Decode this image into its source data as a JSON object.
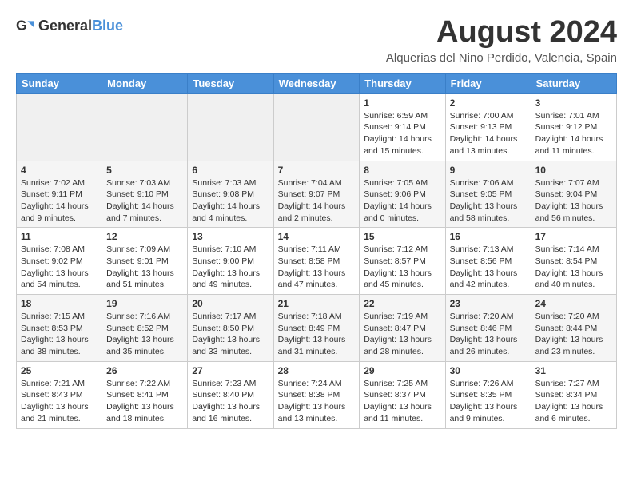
{
  "header": {
    "logo_general": "General",
    "logo_blue": "Blue",
    "title": "August 2024",
    "location": "Alquerias del Nino Perdido, Valencia, Spain"
  },
  "calendar": {
    "days_of_week": [
      "Sunday",
      "Monday",
      "Tuesday",
      "Wednesday",
      "Thursday",
      "Friday",
      "Saturday"
    ],
    "weeks": [
      [
        {
          "day": "",
          "info": ""
        },
        {
          "day": "",
          "info": ""
        },
        {
          "day": "",
          "info": ""
        },
        {
          "day": "",
          "info": ""
        },
        {
          "day": "1",
          "info": "Sunrise: 6:59 AM\nSunset: 9:14 PM\nDaylight: 14 hours\nand 15 minutes."
        },
        {
          "day": "2",
          "info": "Sunrise: 7:00 AM\nSunset: 9:13 PM\nDaylight: 14 hours\nand 13 minutes."
        },
        {
          "day": "3",
          "info": "Sunrise: 7:01 AM\nSunset: 9:12 PM\nDaylight: 14 hours\nand 11 minutes."
        }
      ],
      [
        {
          "day": "4",
          "info": "Sunrise: 7:02 AM\nSunset: 9:11 PM\nDaylight: 14 hours\nand 9 minutes."
        },
        {
          "day": "5",
          "info": "Sunrise: 7:03 AM\nSunset: 9:10 PM\nDaylight: 14 hours\nand 7 minutes."
        },
        {
          "day": "6",
          "info": "Sunrise: 7:03 AM\nSunset: 9:08 PM\nDaylight: 14 hours\nand 4 minutes."
        },
        {
          "day": "7",
          "info": "Sunrise: 7:04 AM\nSunset: 9:07 PM\nDaylight: 14 hours\nand 2 minutes."
        },
        {
          "day": "8",
          "info": "Sunrise: 7:05 AM\nSunset: 9:06 PM\nDaylight: 14 hours\nand 0 minutes."
        },
        {
          "day": "9",
          "info": "Sunrise: 7:06 AM\nSunset: 9:05 PM\nDaylight: 13 hours\nand 58 minutes."
        },
        {
          "day": "10",
          "info": "Sunrise: 7:07 AM\nSunset: 9:04 PM\nDaylight: 13 hours\nand 56 minutes."
        }
      ],
      [
        {
          "day": "11",
          "info": "Sunrise: 7:08 AM\nSunset: 9:02 PM\nDaylight: 13 hours\nand 54 minutes."
        },
        {
          "day": "12",
          "info": "Sunrise: 7:09 AM\nSunset: 9:01 PM\nDaylight: 13 hours\nand 51 minutes."
        },
        {
          "day": "13",
          "info": "Sunrise: 7:10 AM\nSunset: 9:00 PM\nDaylight: 13 hours\nand 49 minutes."
        },
        {
          "day": "14",
          "info": "Sunrise: 7:11 AM\nSunset: 8:58 PM\nDaylight: 13 hours\nand 47 minutes."
        },
        {
          "day": "15",
          "info": "Sunrise: 7:12 AM\nSunset: 8:57 PM\nDaylight: 13 hours\nand 45 minutes."
        },
        {
          "day": "16",
          "info": "Sunrise: 7:13 AM\nSunset: 8:56 PM\nDaylight: 13 hours\nand 42 minutes."
        },
        {
          "day": "17",
          "info": "Sunrise: 7:14 AM\nSunset: 8:54 PM\nDaylight: 13 hours\nand 40 minutes."
        }
      ],
      [
        {
          "day": "18",
          "info": "Sunrise: 7:15 AM\nSunset: 8:53 PM\nDaylight: 13 hours\nand 38 minutes."
        },
        {
          "day": "19",
          "info": "Sunrise: 7:16 AM\nSunset: 8:52 PM\nDaylight: 13 hours\nand 35 minutes."
        },
        {
          "day": "20",
          "info": "Sunrise: 7:17 AM\nSunset: 8:50 PM\nDaylight: 13 hours\nand 33 minutes."
        },
        {
          "day": "21",
          "info": "Sunrise: 7:18 AM\nSunset: 8:49 PM\nDaylight: 13 hours\nand 31 minutes."
        },
        {
          "day": "22",
          "info": "Sunrise: 7:19 AM\nSunset: 8:47 PM\nDaylight: 13 hours\nand 28 minutes."
        },
        {
          "day": "23",
          "info": "Sunrise: 7:20 AM\nSunset: 8:46 PM\nDaylight: 13 hours\nand 26 minutes."
        },
        {
          "day": "24",
          "info": "Sunrise: 7:20 AM\nSunset: 8:44 PM\nDaylight: 13 hours\nand 23 minutes."
        }
      ],
      [
        {
          "day": "25",
          "info": "Sunrise: 7:21 AM\nSunset: 8:43 PM\nDaylight: 13 hours\nand 21 minutes."
        },
        {
          "day": "26",
          "info": "Sunrise: 7:22 AM\nSunset: 8:41 PM\nDaylight: 13 hours\nand 18 minutes."
        },
        {
          "day": "27",
          "info": "Sunrise: 7:23 AM\nSunset: 8:40 PM\nDaylight: 13 hours\nand 16 minutes."
        },
        {
          "day": "28",
          "info": "Sunrise: 7:24 AM\nSunset: 8:38 PM\nDaylight: 13 hours\nand 13 minutes."
        },
        {
          "day": "29",
          "info": "Sunrise: 7:25 AM\nSunset: 8:37 PM\nDaylight: 13 hours\nand 11 minutes."
        },
        {
          "day": "30",
          "info": "Sunrise: 7:26 AM\nSunset: 8:35 PM\nDaylight: 13 hours\nand 9 minutes."
        },
        {
          "day": "31",
          "info": "Sunrise: 7:27 AM\nSunset: 8:34 PM\nDaylight: 13 hours\nand 6 minutes."
        }
      ]
    ]
  }
}
